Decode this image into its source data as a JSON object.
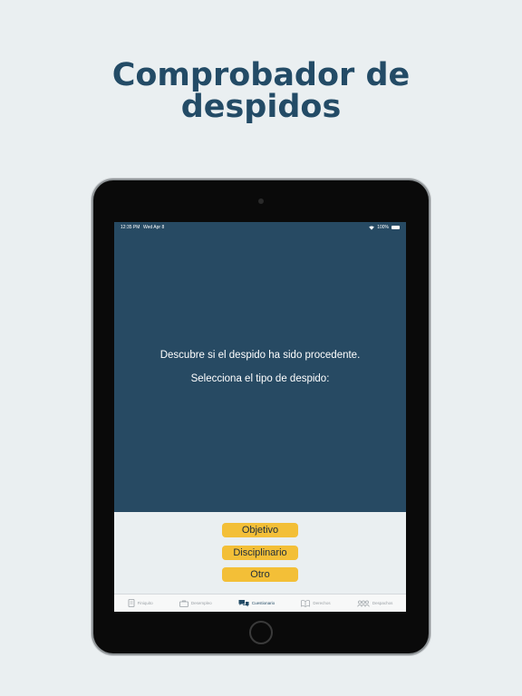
{
  "headline": {
    "line1": "Comprobador de",
    "line2": "despidos"
  },
  "status_bar": {
    "time": "12:35 PM",
    "date": "Wed Apr 8",
    "battery": "100%"
  },
  "prompt": {
    "line1": "Descubre si el despido ha sido procedente.",
    "line2": "Selecciona el tipo de despido:"
  },
  "options": [
    {
      "label": "Objetivo"
    },
    {
      "label": "Disciplinario"
    },
    {
      "label": "Otro"
    }
  ],
  "tab_bar": {
    "items": [
      {
        "label": "Finiquito",
        "icon": "document-icon"
      },
      {
        "label": "Desempleo",
        "icon": "briefcase-icon"
      },
      {
        "label": "Cuestionario",
        "icon": "chat-bubbles-icon",
        "active": true
      },
      {
        "label": "Derechos",
        "icon": "book-icon"
      },
      {
        "label": "Despachos",
        "icon": "people-icon"
      }
    ]
  },
  "colors": {
    "background": "#eaeff1",
    "headline": "#234b66",
    "screen": "#274a63",
    "button": "#f3bf37"
  }
}
